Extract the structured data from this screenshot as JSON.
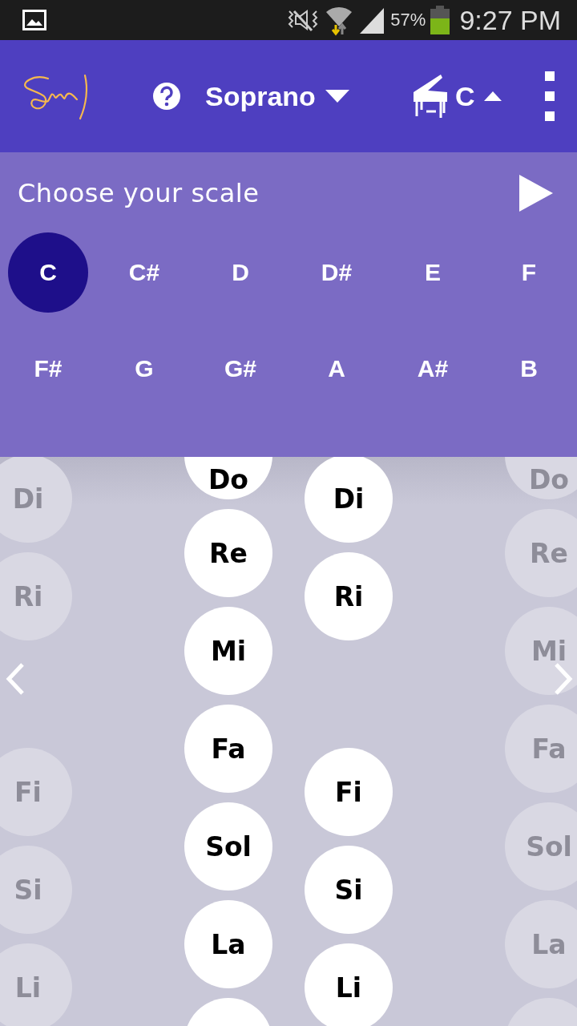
{
  "status_bar": {
    "battery": "57%",
    "time": "9:27 PM"
  },
  "header": {
    "voice": "Soprano",
    "instrument_key": "C"
  },
  "scale_panel": {
    "title": "Choose your scale",
    "keys": [
      {
        "label": "C",
        "selected": true
      },
      {
        "label": "C#",
        "selected": false
      },
      {
        "label": "D",
        "selected": false
      },
      {
        "label": "D#",
        "selected": false
      },
      {
        "label": "E",
        "selected": false
      },
      {
        "label": "F",
        "selected": false
      },
      {
        "label": "F#",
        "selected": false
      },
      {
        "label": "G",
        "selected": false
      },
      {
        "label": "G#",
        "selected": false
      },
      {
        "label": "A",
        "selected": false
      },
      {
        "label": "A#",
        "selected": false
      },
      {
        "label": "B",
        "selected": false
      }
    ]
  },
  "solfege": {
    "columns": [
      {
        "kind": "sharps",
        "faded": true,
        "notes": [
          "Di",
          "Ri",
          "Fi",
          "Si",
          "Li"
        ]
      },
      {
        "kind": "naturals",
        "faded": false,
        "notes": [
          "Do",
          "Re",
          "Mi",
          "Fa",
          "Sol",
          "La"
        ]
      },
      {
        "kind": "sharps",
        "faded": false,
        "notes": [
          "Di",
          "Ri",
          "Fi",
          "Si",
          "Li"
        ]
      },
      {
        "kind": "naturals",
        "faded": true,
        "notes": [
          "Do",
          "Re",
          "Mi",
          "Fa",
          "Sol",
          "La"
        ]
      }
    ]
  }
}
